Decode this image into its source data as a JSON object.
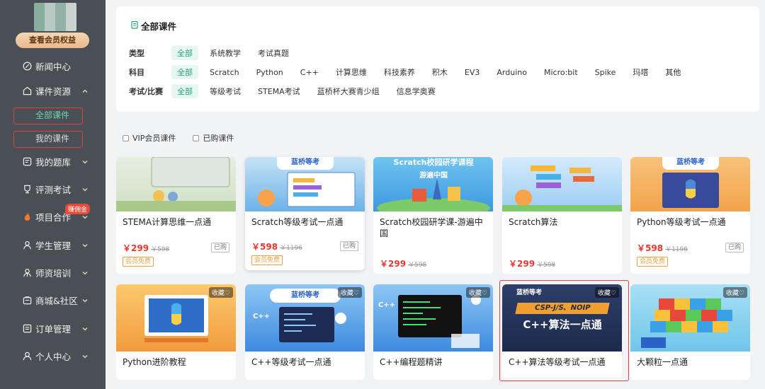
{
  "sidebar": {
    "vip_label": "查看会员权益",
    "items": [
      {
        "label": "新闻中心",
        "icon": "news-icon"
      },
      {
        "label": "课件资源",
        "icon": "courseware-icon",
        "expanded": true
      },
      {
        "label": "我的题库",
        "icon": "question-bank-icon"
      },
      {
        "label": "评测考试",
        "icon": "exam-icon"
      },
      {
        "label": "项目合作",
        "icon": "flame-icon"
      },
      {
        "label": "学生管理",
        "icon": "student-icon"
      },
      {
        "label": "师资培训",
        "icon": "teacher-icon"
      },
      {
        "label": "商城&社区",
        "icon": "shop-icon"
      },
      {
        "label": "订单管理",
        "icon": "order-icon"
      },
      {
        "label": "个人中心",
        "icon": "user-icon"
      }
    ],
    "sub_items": [
      "全部课件",
      "我的课件"
    ],
    "badge": "赚佣金"
  },
  "panel": {
    "title": "全部课件",
    "rows": [
      {
        "label": "类型",
        "options": [
          "全部",
          "系统教学",
          "考试真题"
        ]
      },
      {
        "label": "科目",
        "options": [
          "全部",
          "Scratch",
          "Python",
          "C++",
          "计算思维",
          "科技素养",
          "积木",
          "EV3",
          "Arduino",
          "Micro:bit",
          "Spike",
          "玛塔",
          "其他"
        ]
      },
      {
        "label": "考试/比赛",
        "options": [
          "全部",
          "等级考试",
          "STEMA考试",
          "蓝桥杯大赛青少组",
          "信息学奥赛"
        ]
      }
    ]
  },
  "filters": {
    "vip": "VIP会员课件",
    "bought": "已购课件"
  },
  "cards": [
    {
      "title": "STEMA计算思维一点通",
      "price": "￥299",
      "old_price": "￥598",
      "bought": "已购",
      "free": "会员免费"
    },
    {
      "title": "Scratch等级考试一点通",
      "price": "￥598",
      "old_price": "￥1196",
      "bought": "已购",
      "free": "会员免费"
    },
    {
      "title": "Scratch校园研学课-游遍中国",
      "price": "￥299",
      "old_price": "￥598"
    },
    {
      "title": "Scratch算法",
      "price": "￥299",
      "old_price": "￥598"
    },
    {
      "title": "Python等级考试一点通",
      "price": "￥598",
      "old_price": "￥1196",
      "bought": "已购",
      "free": "会员免费"
    },
    {
      "title": "Python进阶教程",
      "fav": "收藏♡"
    },
    {
      "title": "C++等级考试一点通",
      "fav": "收藏♡"
    },
    {
      "title": "C++编程题精讲",
      "fav": "收藏♡"
    },
    {
      "title": "C++算法等级考试一点通",
      "fav": "收藏♡"
    },
    {
      "title": "大颗粒一点通",
      "fav": "收藏♡"
    }
  ],
  "thumbs": {
    "banner_lanqiao": "蓝桥等考",
    "banner_scratch": "Scratch校园研学课程",
    "banner_scratch_sub": "游遍中国",
    "banner_cspj": "CSP-J/S、NOIP",
    "banner_cpp_algo": "C++算法一点通",
    "cpp_mark": "C++"
  }
}
